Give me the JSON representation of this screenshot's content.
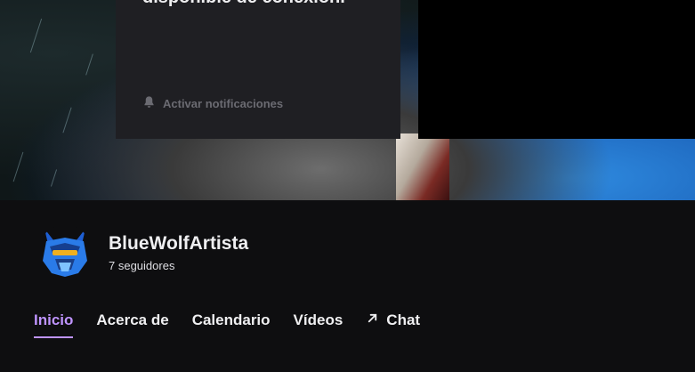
{
  "offline_card": {
    "title": "disponible de conexión.",
    "notify_label": "Activar notificaciones",
    "notify_icon": "bell-icon"
  },
  "channel": {
    "name": "BlueWolfArtista",
    "followers": "7 seguidores",
    "avatar_icon": "wolf-avatar-icon"
  },
  "tabs": [
    {
      "label": "Inicio",
      "active": true
    },
    {
      "label": "Acerca de",
      "active": false
    },
    {
      "label": "Calendario",
      "active": false
    },
    {
      "label": "Vídeos",
      "active": false
    },
    {
      "label": "Chat",
      "active": false,
      "icon": "external-arrow-icon"
    }
  ],
  "colors": {
    "accent": "#bf94ff",
    "background": "#0e0e10",
    "card": "#1f1f23"
  }
}
